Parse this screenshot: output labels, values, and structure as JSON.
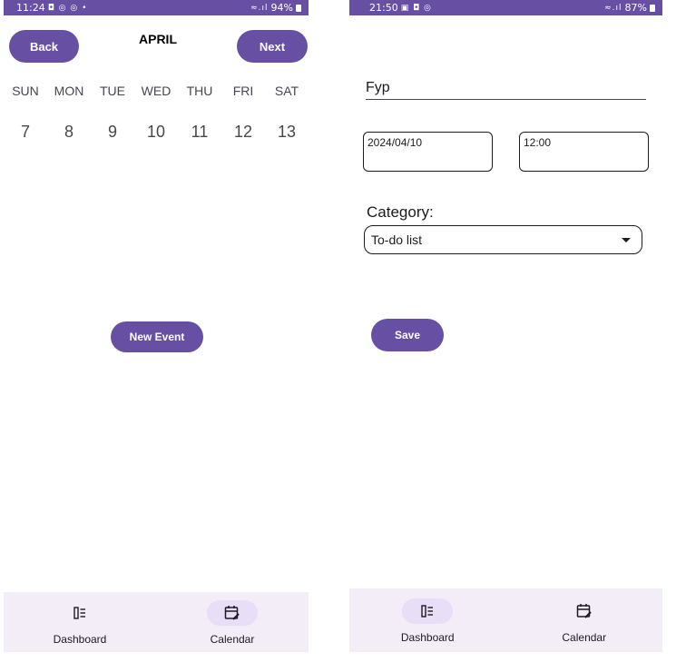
{
  "left_screen": {
    "status": {
      "time": "11:24",
      "icons": "◘ ◎ ◎ •",
      "signal": "≈.ıl",
      "battery": "94%"
    },
    "header": {
      "back_label": "Back",
      "month": "APRIL",
      "next_label": "Next"
    },
    "weekdays": [
      "SUN",
      "MON",
      "TUE",
      "WED",
      "THU",
      "FRI",
      "SAT"
    ],
    "dates": [
      "7",
      "8",
      "9",
      "10",
      "11",
      "12",
      "13"
    ],
    "new_event_label": "New Event",
    "nav": {
      "active": "calendar",
      "items": [
        {
          "label": "Dashboard",
          "icon": "dashboard-icon"
        },
        {
          "label": "Calendar",
          "icon": "calendar-edit-icon"
        }
      ]
    }
  },
  "right_screen": {
    "status": {
      "time": "21:50",
      "icons": "▣ ◘ ◎",
      "signal": "≈.ıl",
      "battery": "87%"
    },
    "form": {
      "title_value": "Fyp",
      "date_value": "2024/04/10",
      "time_value": "12:00",
      "category_label": "Category:",
      "category_value": "To-do list",
      "save_label": "Save"
    },
    "nav": {
      "active": "dashboard",
      "items": [
        {
          "label": "Dashboard",
          "icon": "dashboard-icon"
        },
        {
          "label": "Calendar",
          "icon": "calendar-edit-icon"
        }
      ]
    }
  },
  "colors": {
    "primary": "#6750a4",
    "nav_background": "#f3edf7",
    "nav_indicator": "#e8def8"
  }
}
